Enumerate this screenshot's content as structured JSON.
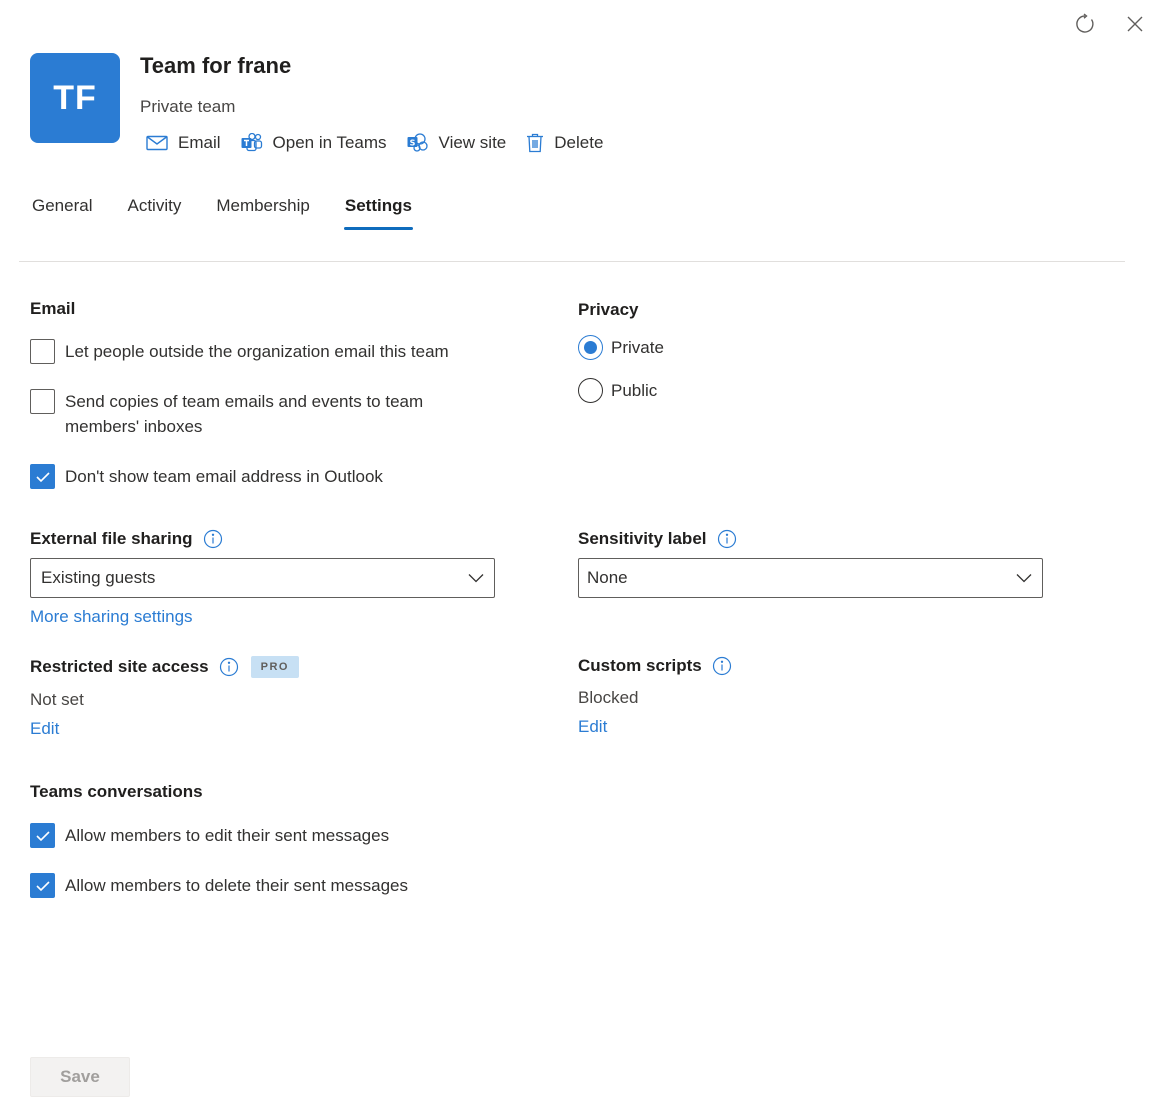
{
  "header": {
    "avatar_initials": "TF",
    "title": "Team for frane",
    "subtitle": "Private team",
    "actions": [
      {
        "label": "Email",
        "icon": "mail-icon"
      },
      {
        "label": "Open in Teams",
        "icon": "teams-icon"
      },
      {
        "label": "View site",
        "icon": "sharepoint-icon"
      },
      {
        "label": "Delete",
        "icon": "trash-icon"
      }
    ],
    "top_icons": [
      "refresh-icon",
      "close-icon"
    ]
  },
  "tabs": [
    {
      "label": "General",
      "active": false
    },
    {
      "label": "Activity",
      "active": false
    },
    {
      "label": "Membership",
      "active": false
    },
    {
      "label": "Settings",
      "active": true
    }
  ],
  "email": {
    "heading": "Email",
    "options": [
      {
        "label": "Let people outside the organization email this team",
        "checked": false
      },
      {
        "label": "Send copies of team emails and events to team members' inboxes",
        "checked": false
      },
      {
        "label": "Don't show team email address in Outlook",
        "checked": true
      }
    ]
  },
  "privacy": {
    "heading": "Privacy",
    "options": [
      {
        "label": "Private",
        "selected": true
      },
      {
        "label": "Public",
        "selected": false
      }
    ]
  },
  "external_sharing": {
    "heading": "External file sharing",
    "value": "Existing guests",
    "link": "More sharing settings"
  },
  "sensitivity": {
    "heading": "Sensitivity label",
    "value": "None"
  },
  "restricted_access": {
    "heading": "Restricted site access",
    "badge": "PRO",
    "value": "Not set",
    "edit": "Edit"
  },
  "custom_scripts": {
    "heading": "Custom scripts",
    "value": "Blocked",
    "edit": "Edit"
  },
  "teams_conversations": {
    "heading": "Teams conversations",
    "options": [
      {
        "label": "Allow members to edit their sent messages",
        "checked": true
      },
      {
        "label": "Allow members to delete their sent messages",
        "checked": true
      }
    ]
  },
  "footer": {
    "save_label": "Save"
  },
  "colors": {
    "accent": "#2b7cd3",
    "active_tab_underline": "#0f6cbd",
    "divider": "#e1dfdd"
  }
}
